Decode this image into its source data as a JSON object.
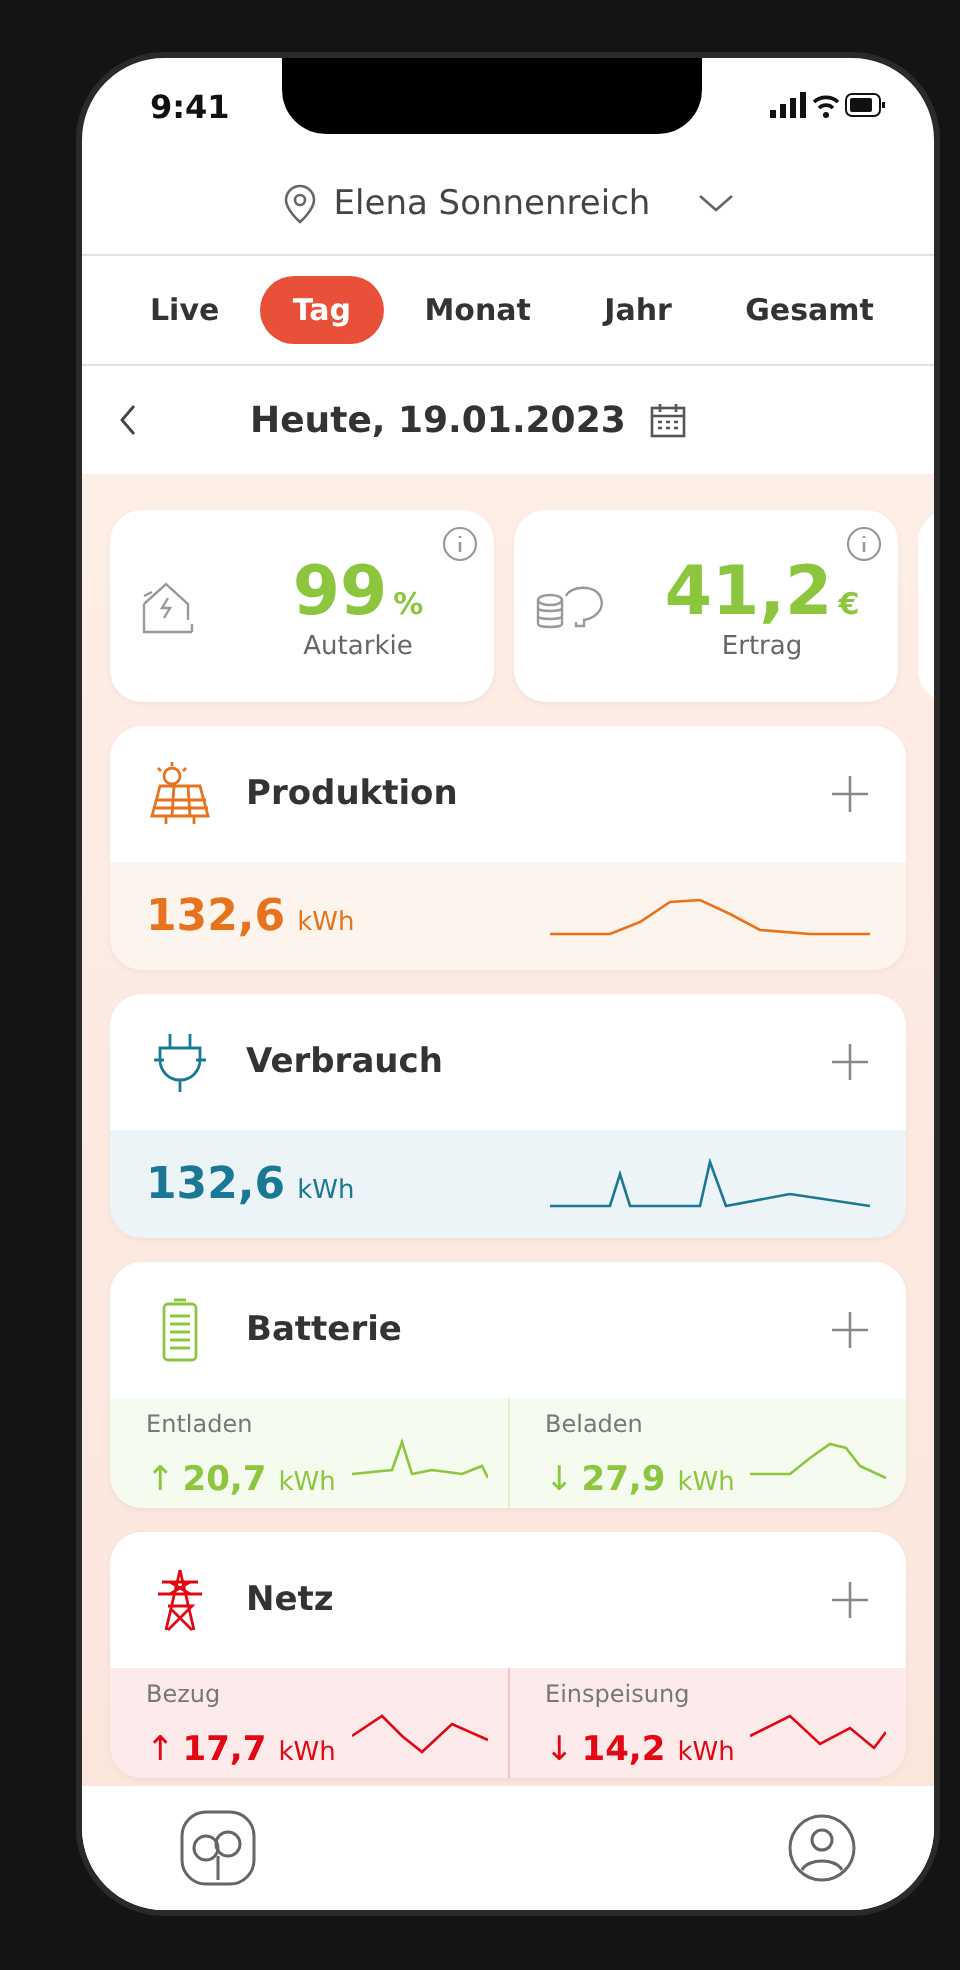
{
  "status_bar": {
    "time": "9:41"
  },
  "location": {
    "name": "Elena Sonnenreich"
  },
  "tabs": [
    {
      "label": "Live",
      "selected": false
    },
    {
      "label": "Tag",
      "selected": true
    },
    {
      "label": "Monat",
      "selected": false
    },
    {
      "label": "Jahr",
      "selected": false
    },
    {
      "label": "Gesamt",
      "selected": false
    }
  ],
  "date": {
    "label": "Heute, 19.01.2023"
  },
  "kpis": [
    {
      "value": "99",
      "unit": "%",
      "label": "Autarkie"
    },
    {
      "value": "41,2",
      "unit": "€",
      "label": "Ertrag"
    }
  ],
  "cards": [
    {
      "kind": "single",
      "title": "Produktion",
      "color": "#e8731f",
      "value": "132,6",
      "unit": "kWh"
    },
    {
      "kind": "single",
      "title": "Verbrauch",
      "color": "#1b7894",
      "value": "132,6",
      "unit": "kWh"
    },
    {
      "kind": "split",
      "title": "Batterie",
      "color": "#8cc63e",
      "parts": [
        {
          "label": "Entladen",
          "arrow": "↑",
          "value": "20,7",
          "unit": "kWh"
        },
        {
          "label": "Beladen",
          "arrow": "↓",
          "value": "27,9",
          "unit": "kWh"
        }
      ]
    },
    {
      "kind": "split",
      "title": "Netz",
      "color": "#e30613",
      "parts": [
        {
          "label": "Bezug",
          "arrow": "↑",
          "value": "17,7",
          "unit": "kWh"
        },
        {
          "label": "Einspeisung",
          "arrow": "↓",
          "value": "14,2",
          "unit": "kWh"
        }
      ]
    }
  ]
}
